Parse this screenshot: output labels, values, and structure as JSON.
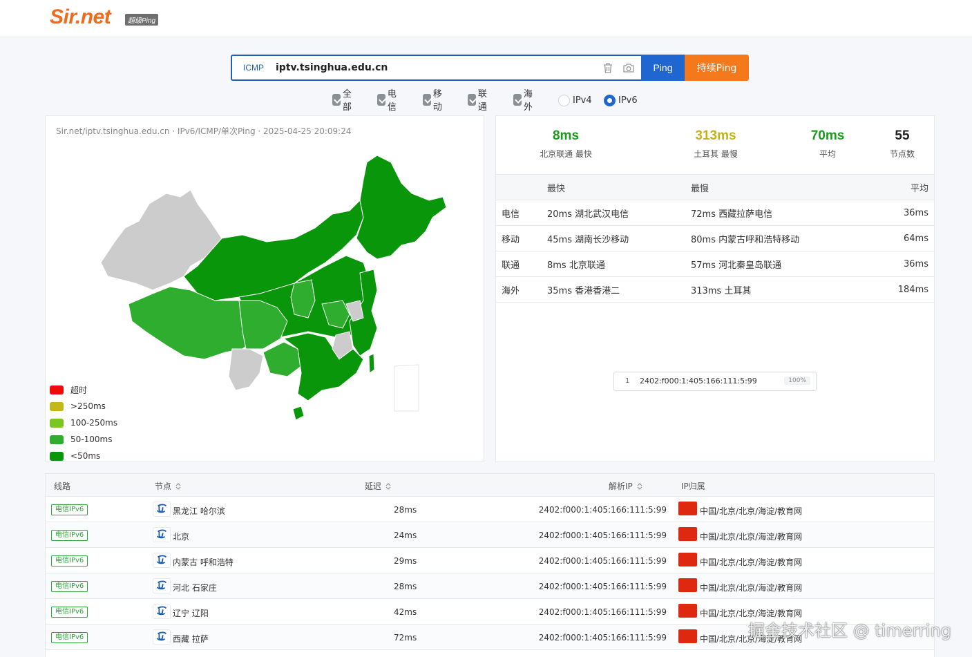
{
  "header": {
    "logo": "Sir.net",
    "badge": "超级Ping"
  },
  "search": {
    "protocol": "ICMP",
    "value": "iptv.tsinghua.edu.cn",
    "ping_label": "Ping",
    "continuous_label": "持续Ping"
  },
  "filters": {
    "checkboxes": [
      "全部",
      "电信",
      "移动",
      "联通",
      "海外"
    ],
    "radios": [
      {
        "label": "IPv4",
        "checked": false
      },
      {
        "label": "IPv6",
        "checked": true
      }
    ]
  },
  "map": {
    "meta": "Sir.net/iptv.tsinghua.edu.cn · IPv6/ICMP/单次Ping · 2025-04-25 20:09:24",
    "legend": [
      {
        "label": "超时",
        "color": "#ee0b0b"
      },
      {
        "label": ">250ms",
        "color": "#c3b71b"
      },
      {
        "label": "100-250ms",
        "color": "#7cc623"
      },
      {
        "label": "50-100ms",
        "color": "#2fad2f"
      },
      {
        "label": "<50ms",
        "color": "#0a960a"
      }
    ]
  },
  "summary": {
    "fastest": {
      "value": "8ms",
      "label": "北京联通 最快",
      "color": "#1a9a1a"
    },
    "slowest": {
      "value": "313ms",
      "label": "土耳其 最慢",
      "color": "#c3b21b"
    },
    "average": {
      "value": "70ms",
      "label": "平均",
      "color": "#1a9a1a"
    },
    "nodes": {
      "value": "55",
      "label": "节点数",
      "color": "#222222"
    }
  },
  "isp_table": {
    "headers": [
      "",
      "最快",
      "最慢",
      "平均"
    ],
    "rows": [
      [
        "电信",
        "20ms 湖北武汉电信",
        "72ms 西藏拉萨电信",
        "36ms"
      ],
      [
        "移动",
        "45ms 湖南长沙移动",
        "80ms 内蒙古呼和浩特移动",
        "64ms"
      ],
      [
        "联通",
        "8ms 北京联通",
        "57ms 河北秦皇岛联通",
        "36ms"
      ],
      [
        "海外",
        "35ms 香港香港二",
        "313ms 土耳其",
        "184ms"
      ]
    ]
  },
  "ip_summary": {
    "index": "1",
    "ip": "2402:f000:1:405:166:111:5:99",
    "pct": "100%"
  },
  "list": {
    "headers": {
      "line": "线路",
      "node": "节点",
      "delay": "延迟",
      "ip": "解析IP",
      "geo": "IP归属"
    },
    "rows": [
      {
        "tag": "电信IPv6",
        "node": "黑龙江 哈尔滨",
        "delay": "28ms",
        "ip": "2402:f000:1:405:166:111:5:99",
        "geo": "中国/北京/北京/海淀/教育网"
      },
      {
        "tag": "电信IPv6",
        "node": "北京",
        "delay": "24ms",
        "ip": "2402:f000:1:405:166:111:5:99",
        "geo": "中国/北京/北京/海淀/教育网"
      },
      {
        "tag": "电信IPv6",
        "node": "内蒙古 呼和浩特",
        "delay": "29ms",
        "ip": "2402:f000:1:405:166:111:5:99",
        "geo": "中国/北京/北京/海淀/教育网"
      },
      {
        "tag": "电信IPv6",
        "node": "河北 石家庄",
        "delay": "28ms",
        "ip": "2402:f000:1:405:166:111:5:99",
        "geo": "中国/北京/北京/海淀/教育网"
      },
      {
        "tag": "电信IPv6",
        "node": "辽宁 辽阳",
        "delay": "42ms",
        "ip": "2402:f000:1:405:166:111:5:99",
        "geo": "中国/北京/北京/海淀/教育网"
      },
      {
        "tag": "电信IPv6",
        "node": "西藏 拉萨",
        "delay": "72ms",
        "ip": "2402:f000:1:405:166:111:5:99",
        "geo": "中国/北京/北京/海淀/教育网"
      }
    ]
  },
  "watermark": "掘金技术社区 @ timerring"
}
